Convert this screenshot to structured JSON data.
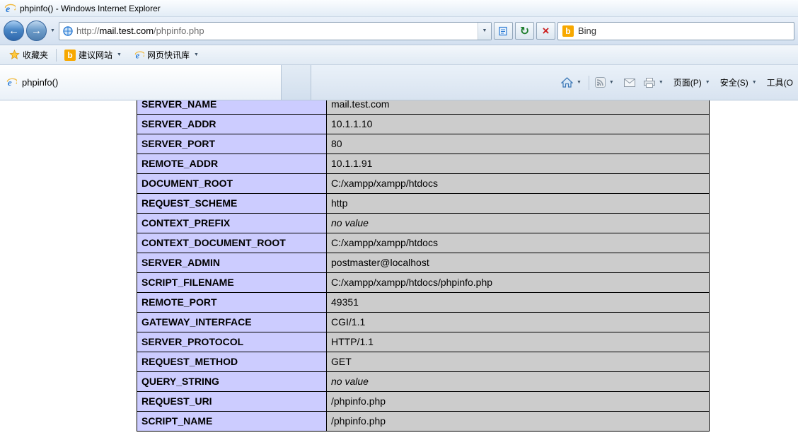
{
  "window": {
    "title": "phpinfo() - Windows Internet Explorer"
  },
  "icons": {
    "back": "←",
    "forward": "→",
    "dropdown": "▼",
    "refresh": "↻",
    "stop": "×",
    "bing_logo": "b"
  },
  "navbar": {
    "url_scheme": "http://",
    "url_domain": "mail.test.com",
    "url_path": "/phpinfo.php",
    "search_engine": "Bing"
  },
  "favorites_bar": {
    "favorites": "收藏夹",
    "suggested_sites": "建议网站",
    "web_slice_gallery": "网页快讯库"
  },
  "tab": {
    "label": "phpinfo()"
  },
  "command_bar": {
    "page": "页面(P)",
    "safety": "安全(S)",
    "tools": "工具(O"
  },
  "content": {
    "colors": {
      "name_cell_bg": "#ccccff",
      "value_cell_bg": "#cccccc"
    },
    "rows": [
      {
        "name": "SERVER_NAME",
        "value": "mail.test.com"
      },
      {
        "name": "SERVER_ADDR",
        "value": "10.1.1.10"
      },
      {
        "name": "SERVER_PORT",
        "value": "80"
      },
      {
        "name": "REMOTE_ADDR",
        "value": "10.1.1.91"
      },
      {
        "name": "DOCUMENT_ROOT",
        "value": "C:/xampp/xampp/htdocs"
      },
      {
        "name": "REQUEST_SCHEME",
        "value": "http"
      },
      {
        "name": "CONTEXT_PREFIX",
        "value": "no value",
        "italic": true
      },
      {
        "name": "CONTEXT_DOCUMENT_ROOT",
        "value": "C:/xampp/xampp/htdocs"
      },
      {
        "name": "SERVER_ADMIN",
        "value": "postmaster@localhost"
      },
      {
        "name": "SCRIPT_FILENAME",
        "value": "C:/xampp/xampp/htdocs/phpinfo.php"
      },
      {
        "name": "REMOTE_PORT",
        "value": "49351"
      },
      {
        "name": "GATEWAY_INTERFACE",
        "value": "CGI/1.1"
      },
      {
        "name": "SERVER_PROTOCOL",
        "value": "HTTP/1.1"
      },
      {
        "name": "REQUEST_METHOD",
        "value": "GET"
      },
      {
        "name": "QUERY_STRING",
        "value": "no value",
        "italic": true
      },
      {
        "name": "REQUEST_URI",
        "value": "/phpinfo.php"
      },
      {
        "name": "SCRIPT_NAME",
        "value": "/phpinfo.php"
      }
    ]
  }
}
